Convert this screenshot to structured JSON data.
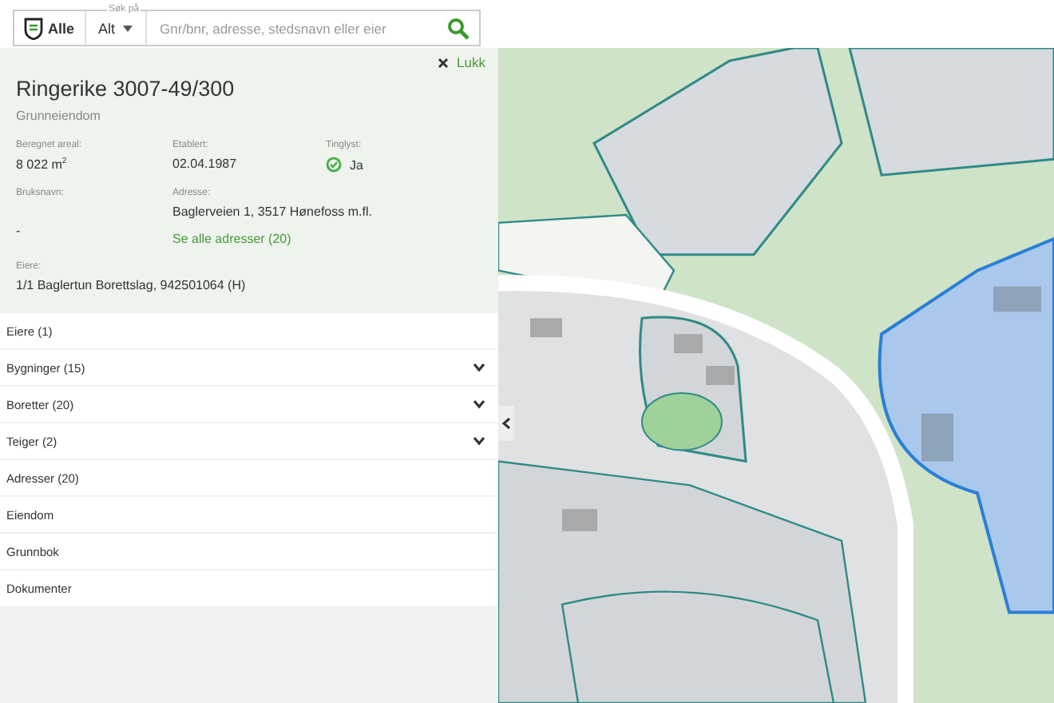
{
  "search": {
    "scope_button": "Alle",
    "filter_legend": "Søk på",
    "filter_value": "Alt",
    "placeholder": "Gnr/bnr, adresse, stedsnavn eller eier"
  },
  "details": {
    "close_label": "Lukk",
    "title": "Ringerike 3007-49/300",
    "subtitle": "Grunneiendom",
    "fields": [
      {
        "label": "Beregnet areal:",
        "value": "8 022 m$^{2}$"
      },
      {
        "label": "Etablert:",
        "value": "02.04.1987"
      },
      {
        "label": "Tinglyst:",
        "value": "Ja",
        "checked": true
      }
    ],
    "bruksnavn": {
      "label": "Bruksnavn:",
      "value": "-"
    },
    "address": {
      "label": "Adresse:",
      "value": "Baglerveien 1, 3517 Hønefoss m.fl.",
      "link": "Se alle adresser (20)"
    },
    "owners": {
      "label": "Eiere:",
      "value": "1/1 Baglertun Borettslag, 942501064 (H)"
    }
  },
  "sections": [
    {
      "label": "Eiere (1)",
      "expandable": false
    },
    {
      "label": "Bygninger (15)",
      "expandable": true
    },
    {
      "label": "Boretter (20)",
      "expandable": true
    },
    {
      "label": "Teiger (2)",
      "expandable": true
    },
    {
      "label": "Adresser (20)",
      "expandable": false
    },
    {
      "label": "Eiendom",
      "expandable": false
    },
    {
      "label": "Grunnbok",
      "expandable": false
    },
    {
      "label": "Dokumenter",
      "expandable": false
    }
  ]
}
